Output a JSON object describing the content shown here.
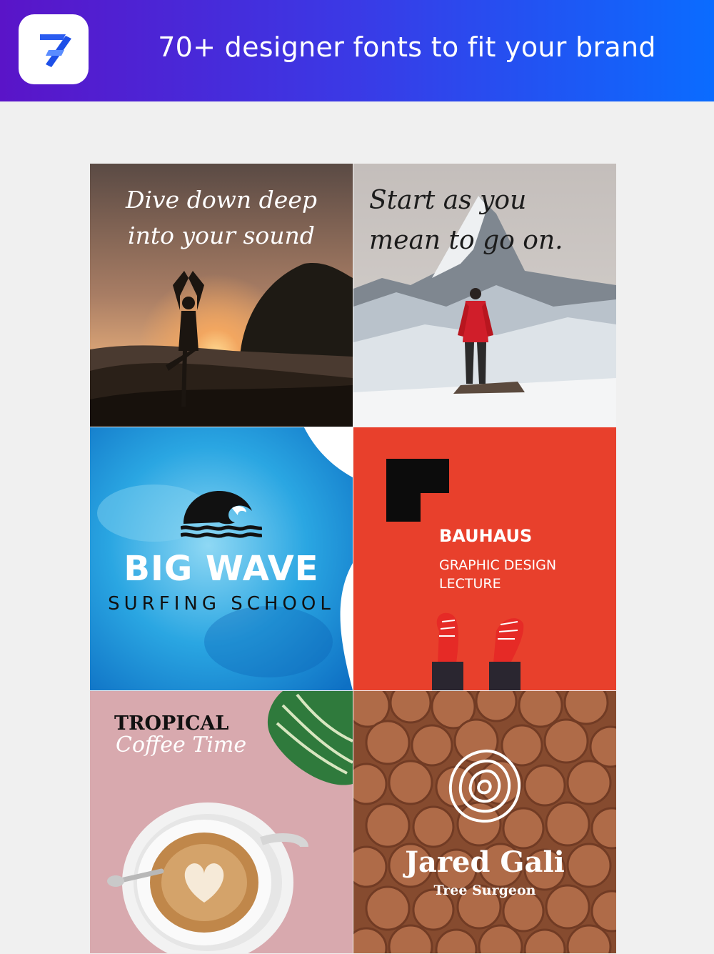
{
  "header": {
    "title": "70+ designer fonts to fit your brand",
    "icon": "app-logo-icon",
    "gradient": [
      "#5a14c8",
      "#0a6cff"
    ]
  },
  "tiles": {
    "yoga": {
      "line1": "Dive down deep",
      "line2": "into your sound"
    },
    "mountain": {
      "line1": "Start as you",
      "line2": "mean to go on."
    },
    "wave": {
      "title": "BIG WAVE",
      "subtitle": "SURFING SCHOOL"
    },
    "bauhaus": {
      "title": "BAUHAUS",
      "line1": "GRAPHIC DESIGN",
      "line2": "LECTURE"
    },
    "coffee": {
      "title": "TROPICAL",
      "subtitle": "Coffee Time"
    },
    "wood": {
      "title": "Jared Gali",
      "subtitle": "Tree Surgeon"
    }
  }
}
